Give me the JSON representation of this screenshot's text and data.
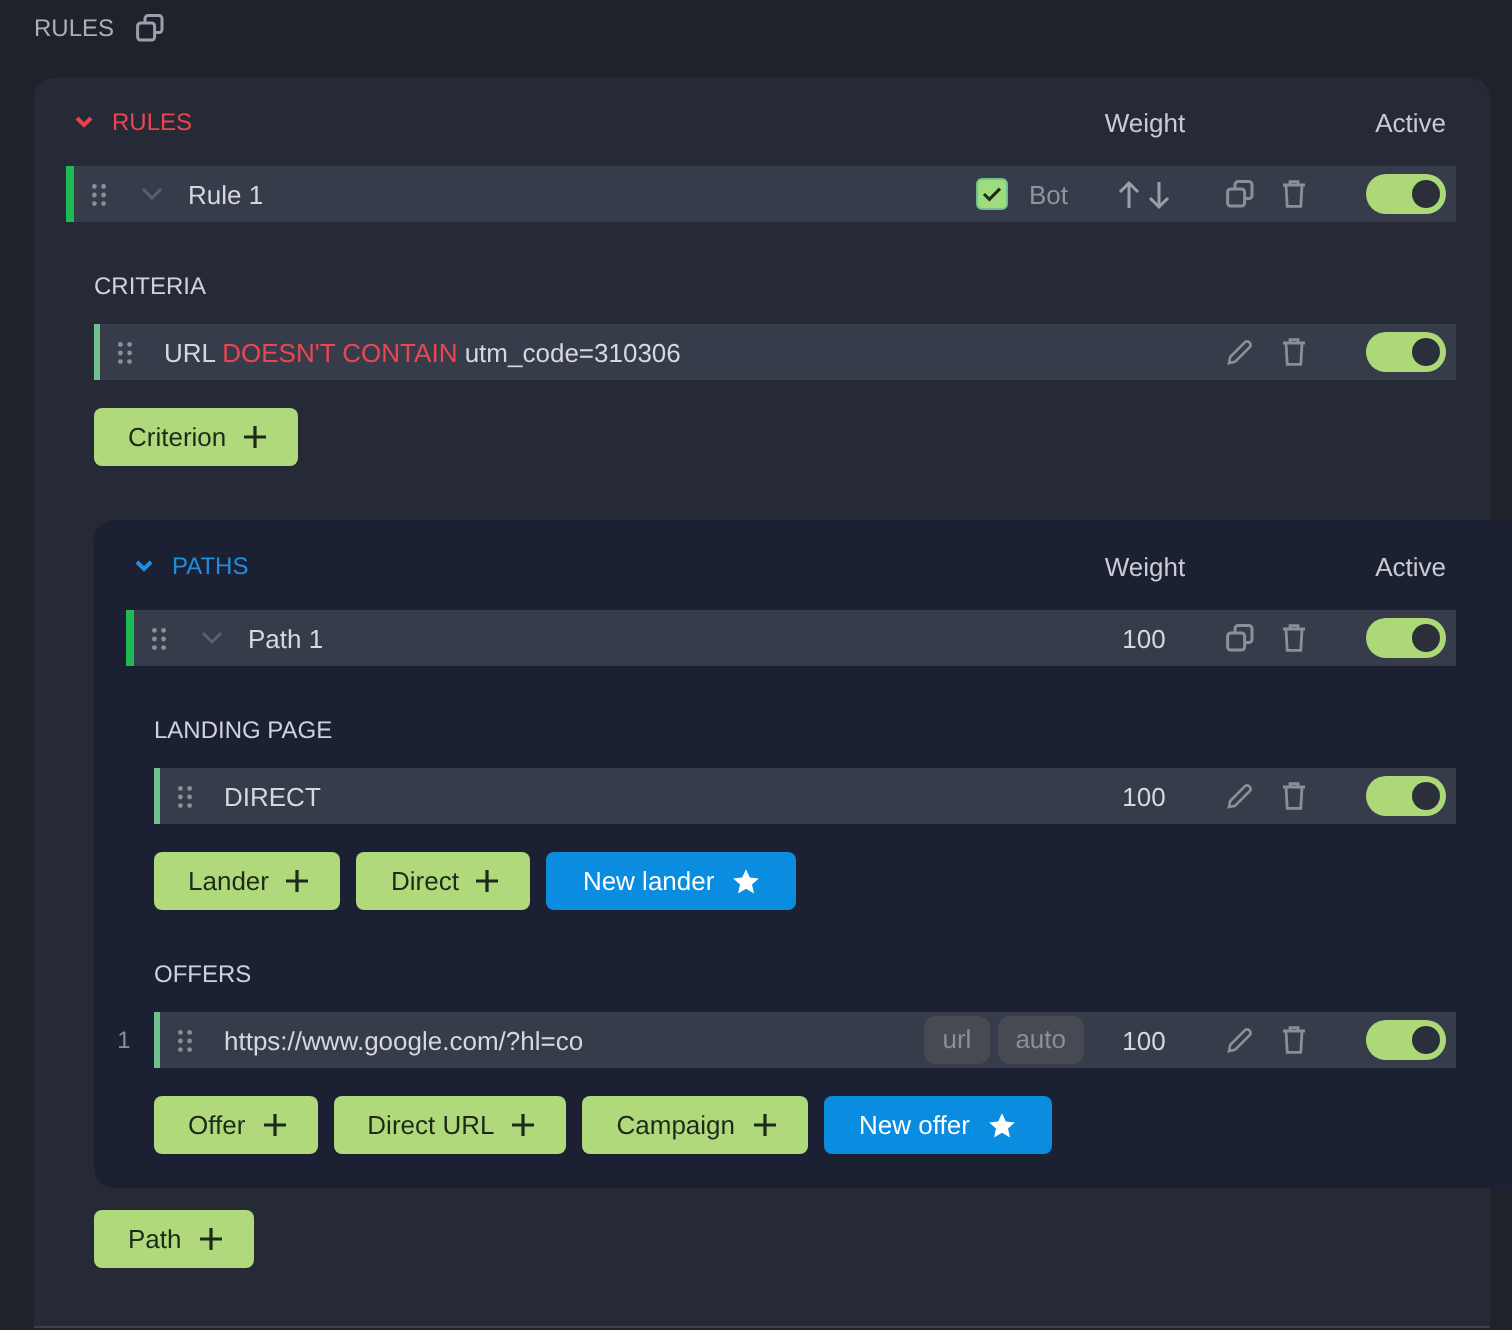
{
  "header": {
    "title": "RULES"
  },
  "rules": {
    "title": "RULES",
    "expanded": true,
    "columns": [
      "Weight",
      "Active"
    ],
    "items": [
      {
        "name": "Rule 1",
        "bot": {
          "label": "Bot",
          "checked": true
        },
        "active": true
      }
    ],
    "criteria": {
      "title": "CRITERIA",
      "items": [
        {
          "field": "URL",
          "operator": "DOESN'T CONTAIN",
          "value": "utm_code=310306",
          "active": true
        }
      ],
      "add_button": "Criterion"
    },
    "paths": {
      "title": "PATHS",
      "expanded": true,
      "columns": [
        "Weight",
        "Active"
      ],
      "items": [
        {
          "name": "Path 1",
          "weight": "100",
          "active": true
        }
      ],
      "landing": {
        "title": "LANDING PAGE",
        "items": [
          {
            "name": "DIRECT",
            "weight": "100",
            "active": true
          }
        ],
        "buttons": [
          {
            "label": "Lander",
            "kind": "add"
          },
          {
            "label": "Direct",
            "kind": "add"
          },
          {
            "label": "New lander",
            "kind": "new"
          }
        ]
      },
      "offers": {
        "title": "OFFERS",
        "items": [
          {
            "number": "1",
            "name": "https://www.google.com/?hl=co",
            "tags": [
              "url",
              "auto"
            ],
            "weight": "100",
            "active": true
          }
        ],
        "buttons": [
          {
            "label": "Offer",
            "kind": "add"
          },
          {
            "label": "Direct URL",
            "kind": "add"
          },
          {
            "label": "Campaign",
            "kind": "add"
          },
          {
            "label": "New offer",
            "kind": "new"
          }
        ]
      }
    },
    "add_button": "Path"
  }
}
